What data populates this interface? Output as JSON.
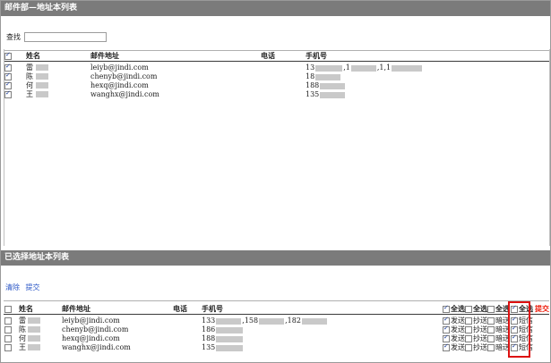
{
  "top_panel": {
    "title": "邮件部—地址本列表",
    "search_label": "查找",
    "search_value": "",
    "columns": [
      "姓名",
      "邮件地址",
      "电话",
      "手机号"
    ],
    "rows": [
      {
        "checked": true,
        "name": "雷",
        "email": "leiyb@jindi.com",
        "phone": "",
        "mobile": "13",
        "mobile_extra": [
          ",1",
          ",1,1"
        ]
      },
      {
        "checked": true,
        "name": "陈",
        "email": "chenyb@jindi.com",
        "phone": "",
        "mobile": "18",
        "mobile_extra": []
      },
      {
        "checked": true,
        "name": "何",
        "email": "hexq@jindi.com",
        "phone": "",
        "mobile": "188",
        "mobile_extra": []
      },
      {
        "checked": true,
        "name": "王",
        "email": "wanghx@jindi.com",
        "phone": "",
        "mobile": "135",
        "mobile_extra": []
      }
    ]
  },
  "bottom_panel": {
    "title": "已选择地址本列表",
    "clear_label": "清除",
    "submit_label": "提交",
    "columns": [
      "姓名",
      "邮件地址",
      "电话",
      "手机号"
    ],
    "select_all": [
      "全选",
      "全选",
      "全选",
      "全选"
    ],
    "submit_red": "提交",
    "option_labels": [
      "发送",
      "抄送",
      "暗送",
      "短信"
    ],
    "rows": [
      {
        "name": "雷",
        "email": "leiyb@jindi.com",
        "mobile": "133",
        "mobile_extra": [
          ",158",
          ",182"
        ],
        "send": true,
        "cc": false,
        "bcc": false,
        "sms": true
      },
      {
        "name": "陈",
        "email": "chenyb@jindi.com",
        "mobile": "186",
        "mobile_extra": [],
        "send": true,
        "cc": false,
        "bcc": false,
        "sms": true
      },
      {
        "name": "何",
        "email": "hexq@jindi.com",
        "mobile": "188",
        "mobile_extra": [],
        "send": true,
        "cc": false,
        "bcc": false,
        "sms": true
      },
      {
        "name": "王",
        "email": "wanghx@jindi.com",
        "mobile": "135",
        "mobile_extra": [],
        "send": true,
        "cc": false,
        "bcc": false,
        "sms": true
      }
    ]
  }
}
